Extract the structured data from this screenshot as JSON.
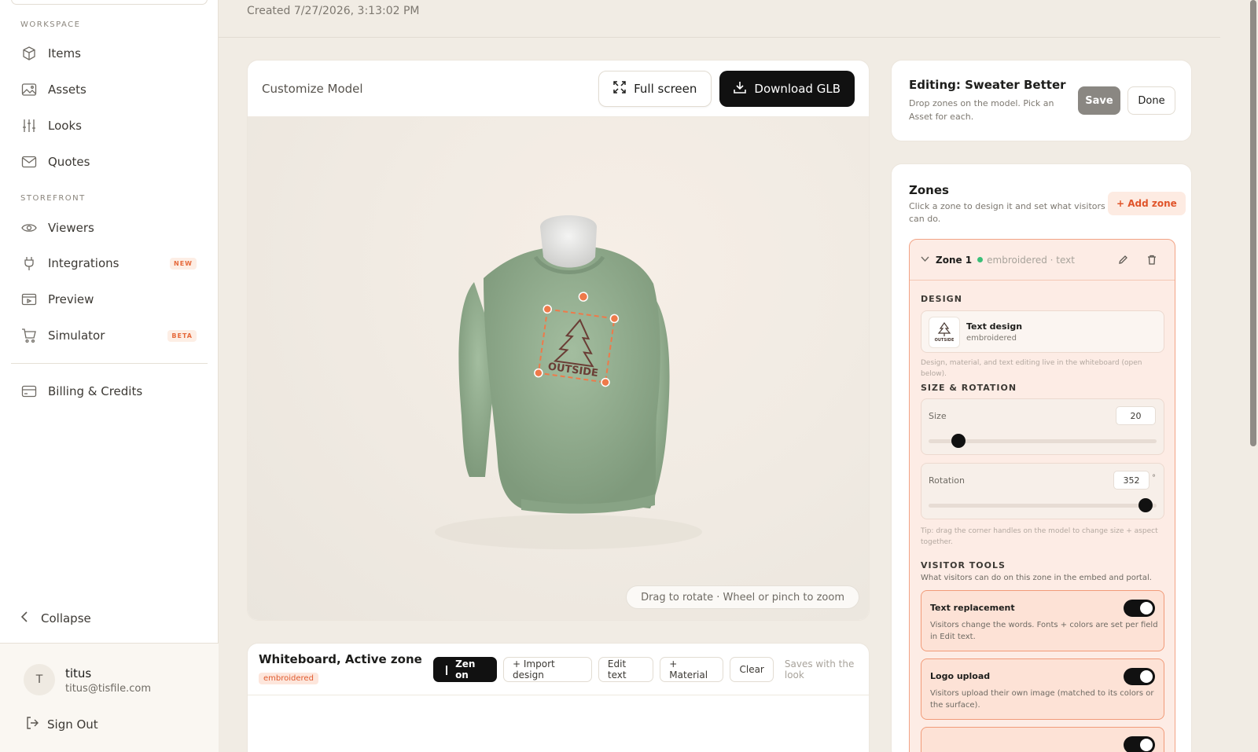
{
  "sidebar": {
    "workspace_label": "WORKSPACE",
    "storefront_label": "STOREFRONT",
    "workspace_items": [
      {
        "label": "Items",
        "icon": "box-icon"
      },
      {
        "label": "Assets",
        "icon": "image-icon"
      },
      {
        "label": "Looks",
        "icon": "sliders-icon"
      },
      {
        "label": "Quotes",
        "icon": "mail-icon"
      }
    ],
    "storefront_items": [
      {
        "label": "Viewers",
        "icon": "eye-icon"
      },
      {
        "label": "Integrations",
        "icon": "plug-icon",
        "badge": "NEW"
      },
      {
        "label": "Preview",
        "icon": "preview-icon"
      },
      {
        "label": "Simulator",
        "icon": "cart-icon",
        "badge": "BETA"
      }
    ],
    "billing_label": "Billing & Credits",
    "collapse_label": "Collapse",
    "user": {
      "initial": "T",
      "name": "titus",
      "email": "titus@tisfile.com"
    },
    "signout_label": "Sign Out"
  },
  "header": {
    "created": "Created 7/27/2026, 3:13:02 PM"
  },
  "viewer": {
    "title": "Customize Model",
    "fullscreen_label": "Full screen",
    "download_label": "Download GLB",
    "hint": "Drag to rotate · Wheel or pinch to zoom",
    "print_text": "OUTSIDE"
  },
  "whiteboard": {
    "title": "Whiteboard, Active zone",
    "tag": "embroidered",
    "tools": {
      "zen": "Zen on",
      "import": "+ Import design",
      "edit_text": "Edit text",
      "material": "+ Material",
      "clear": "Clear"
    },
    "note": "Saves with the look"
  },
  "editing": {
    "title": "Editing: Sweater Better",
    "subtitle": "Drop zones on the model. Pick an Asset for each.",
    "save_label": "Save",
    "done_label": "Done"
  },
  "zones": {
    "title": "Zones",
    "subtitle": "Click a zone to design it and set what visitors can do.",
    "add_label": "+ Add zone",
    "zone1": {
      "name": "Zone 1",
      "meta": "embroidered · text",
      "design_label": "DESIGN",
      "design_name": "Text design",
      "design_kind": "embroidered",
      "design_thumb_text": "OUTSIDE",
      "design_note": "Design, material, and text editing live in the whiteboard (open below).",
      "size_rotation_label": "SIZE & ROTATION",
      "size_label": "Size",
      "size_value": "20",
      "size_fraction": 0.13,
      "rotation_label": "Rotation",
      "rotation_value": "352",
      "rotation_unit": "°",
      "rotation_fraction": 0.95,
      "tip": "Tip: drag the corner handles on the model to change size + aspect together.",
      "visitor_label": "VISITOR TOOLS",
      "visitor_sub": "What visitors can do on this zone in the embed and portal.",
      "tools": [
        {
          "title": "Text replacement",
          "desc": "Visitors change the words. Fonts + colors are set per field in Edit text.",
          "enabled": true
        },
        {
          "title": "Logo upload",
          "desc": "Visitors upload their own image (matched to its colors or the surface).",
          "enabled": true
        }
      ]
    }
  },
  "colors": {
    "accent": "#e66a3c",
    "zone_border": "#f2a486",
    "sweater": "#93ad8f",
    "dark": "#111111"
  }
}
